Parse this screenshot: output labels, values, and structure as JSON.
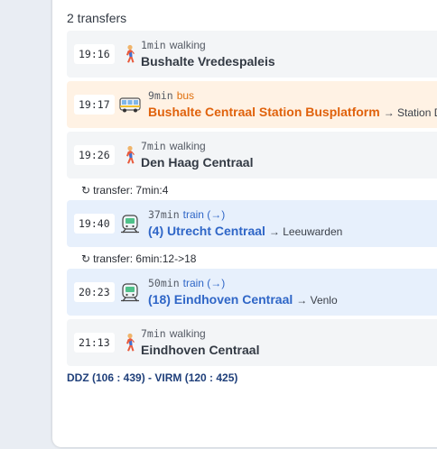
{
  "heading": "2 transfers",
  "legs": [
    {
      "time": "19:16",
      "icon": "walking-person-icon",
      "duration": "1min",
      "mode": "walking",
      "stop": "Bushalte Vredespaleis",
      "direction": ""
    },
    {
      "time": "19:17",
      "icon": "bus-icon",
      "duration": "9min",
      "mode": "bus",
      "stop": "Bushalte Centraal Station Busplatform",
      "direction": "→ Station DI"
    },
    {
      "time": "19:26",
      "icon": "walking-person-icon",
      "duration": "7min",
      "mode": "walking",
      "stop": "Den Haag Centraal",
      "direction": ""
    },
    {
      "time": "19:40",
      "icon": "train-icon",
      "duration": "37min",
      "mode": "train (→)",
      "stop": "(4) Utrecht Centraal",
      "direction": "→ Leeuwarden"
    },
    {
      "time": "20:23",
      "icon": "train-icon",
      "duration": "50min",
      "mode": "train (→)",
      "stop": "(18) Eindhoven Centraal",
      "direction": "→ Venlo"
    },
    {
      "time": "21:13",
      "icon": "walking-person-icon",
      "duration": "7min",
      "mode": "walking",
      "stop": "Eindhoven Centraal",
      "direction": ""
    }
  ],
  "transfers": [
    {
      "icon": "↻",
      "label": "transfer: 7min:4"
    },
    {
      "icon": "↻",
      "label": "transfer: 6min:12->18"
    }
  ],
  "footer": "DDZ (106 : 439) - VIRM (120 : 425)",
  "colors": {
    "bus_accent": "#e0620c",
    "train_accent": "#2f66c7",
    "walk_bg": "#f3f5f7",
    "bus_bg": "#fff2e4",
    "train_bg": "#e7f0fc"
  }
}
